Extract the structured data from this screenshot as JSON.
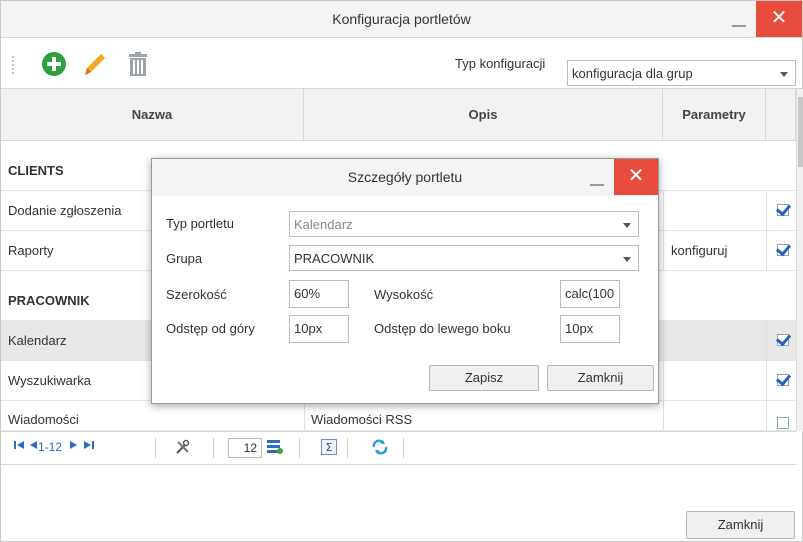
{
  "window": {
    "title": "Konfiguracja portletów",
    "close_glyph": "✕",
    "close_label": "Zamknij"
  },
  "toolbar": {
    "icons": [
      "add-icon",
      "edit-icon",
      "delete-icon"
    ],
    "typ_label": "Typ konfiguracji",
    "typ_value": "konfiguracja dla grup"
  },
  "grid": {
    "columns": [
      "Nazwa",
      "Opis",
      "Parametry"
    ],
    "rows": [
      {
        "type": "group",
        "name": "CLIENTS"
      },
      {
        "type": "item",
        "name": "Dodanie zgłoszenia",
        "opis": "",
        "param": "",
        "checked": true
      },
      {
        "type": "item",
        "name": "Raporty",
        "opis": "",
        "param": "konfiguruj",
        "checked": true
      },
      {
        "type": "group",
        "name": "PRACOWNIK"
      },
      {
        "type": "item",
        "name": "Kalendarz",
        "opis": "",
        "param": "",
        "checked": true,
        "selected": true
      },
      {
        "type": "item",
        "name": "Wyszukiwarka",
        "opis": "",
        "param": "",
        "checked": true
      },
      {
        "type": "item",
        "name": "Wiadomości",
        "opis": "Wiadomości RSS",
        "param": "",
        "checked": false
      }
    ]
  },
  "pager": {
    "range": "1-12",
    "page_size": "12"
  },
  "dialog": {
    "title": "Szczegóły portletu",
    "close_glyph": "✕",
    "typ_label": "Typ portletu",
    "typ_value": "Kalendarz",
    "grupa_label": "Grupa",
    "grupa_value": "PRACOWNIK",
    "szerokosc_label": "Szerokość",
    "szerokosc_value": "60%",
    "wysokosc_label": "Wysokość",
    "wysokosc_value": "calc(100",
    "odstep_gora_label": "Odstęp od góry",
    "odstep_gora_value": "10px",
    "odstep_lewo_label": "Odstęp do lewego boku",
    "odstep_lewo_value": "10px",
    "save_label": "Zapisz",
    "close_label": "Zamknij"
  },
  "colors": {
    "close_red": "#e74c3c",
    "add_green": "#2e9e3e",
    "edit_orange": "#f5a623",
    "link_blue": "#2b6cb0"
  }
}
